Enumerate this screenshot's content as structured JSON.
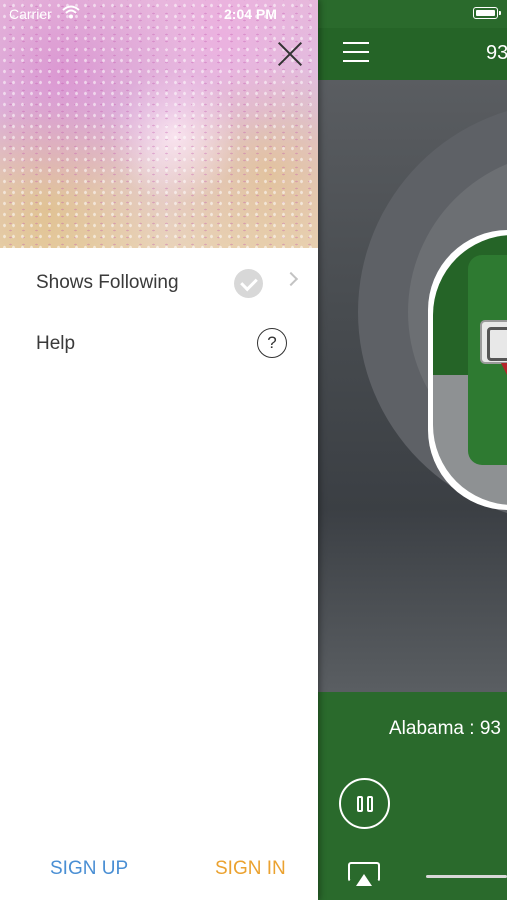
{
  "status_bar": {
    "carrier": "Carrier",
    "time": "2:04 PM"
  },
  "drawer": {
    "menu": [
      {
        "label": "Shows Following",
        "icon": "checkmark-circle-icon"
      },
      {
        "label": "Help",
        "icon": "question-circle-icon"
      }
    ],
    "sign_up": "SIGN UP",
    "sign_in": "SIGN IN"
  },
  "player": {
    "station_title": "93",
    "now_playing": "Alabama : 93",
    "colors": {
      "brand_green": "#256427",
      "sign_up": "#4a8fd4",
      "sign_in": "#eba230"
    }
  }
}
